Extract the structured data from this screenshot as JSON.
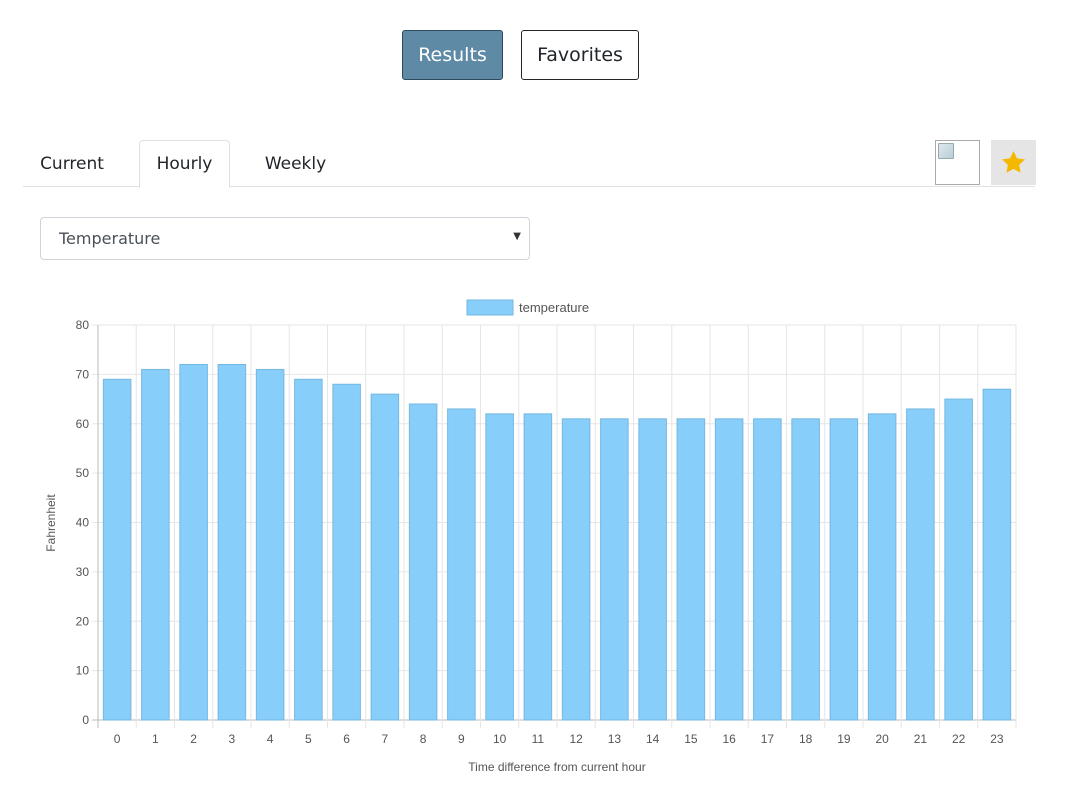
{
  "nav": {
    "results_label": "Results",
    "favorites_label": "Favorites"
  },
  "tabs": {
    "current": "Current",
    "hourly": "Hourly",
    "weekly": "Weekly",
    "active": "Hourly"
  },
  "actions": {
    "tweet_icon": "broken-image-icon",
    "favorite_icon": "star-icon",
    "favorite_color": "#f5b800"
  },
  "select": {
    "value": "Temperature"
  },
  "colors": {
    "primary_button": "#5e8aa6",
    "bar_fill": "#87cefa",
    "bar_border": "#75b8e0"
  },
  "chart_data": {
    "type": "bar",
    "legend": "temperature",
    "legend_position": "top",
    "xlabel": "Time difference from current hour",
    "ylabel": "Fahrenheit",
    "ylim": [
      0,
      80
    ],
    "yticks": [
      0,
      10,
      20,
      30,
      40,
      50,
      60,
      70,
      80
    ],
    "grid": true,
    "categories": [
      "0",
      "1",
      "2",
      "3",
      "4",
      "5",
      "6",
      "7",
      "8",
      "9",
      "10",
      "11",
      "12",
      "13",
      "14",
      "15",
      "16",
      "17",
      "18",
      "19",
      "20",
      "21",
      "22",
      "23"
    ],
    "values": [
      69,
      71,
      72,
      72,
      71,
      69,
      68,
      66,
      64,
      63,
      62,
      62,
      61,
      61,
      61,
      61,
      61,
      61,
      61,
      61,
      62,
      63,
      65,
      67
    ]
  }
}
